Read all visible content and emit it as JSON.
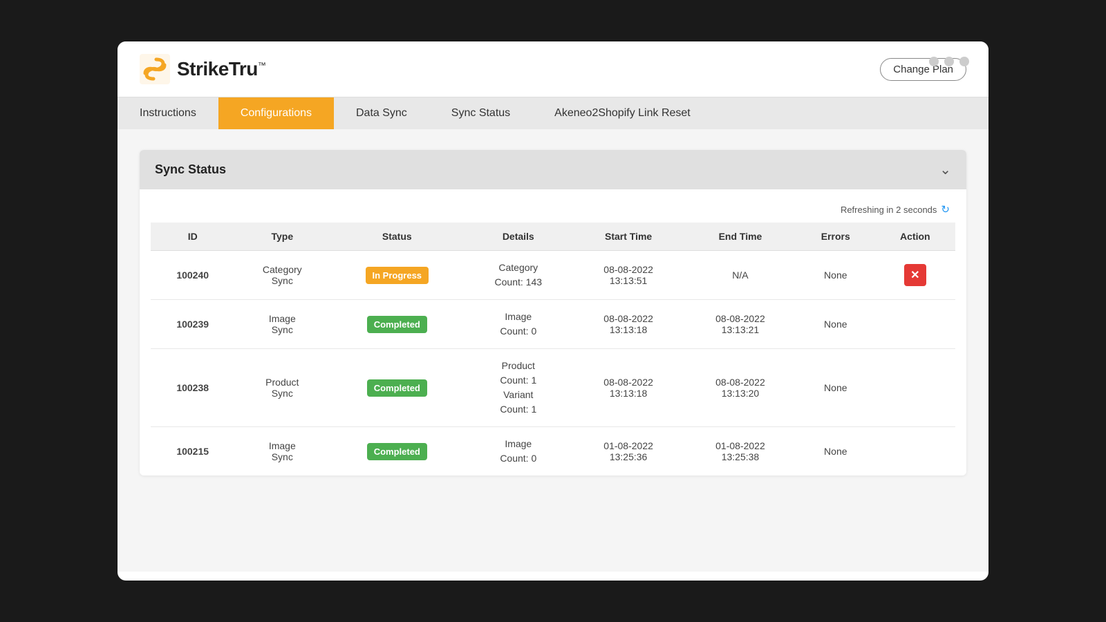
{
  "window": {
    "controls": [
      "dot1",
      "dot2",
      "dot3"
    ]
  },
  "header": {
    "logo_text": "StrikeTru",
    "logo_tm": "™",
    "change_plan_label": "Change Plan"
  },
  "nav": {
    "items": [
      {
        "label": "Instructions",
        "active": false
      },
      {
        "label": "Configurations",
        "active": true
      },
      {
        "label": "Data Sync",
        "active": false
      },
      {
        "label": "Sync Status",
        "active": false
      },
      {
        "label": "Akeneo2Shopify Link Reset",
        "active": false
      }
    ]
  },
  "sync_status_panel": {
    "title": "Sync Status",
    "refresh_text": "Refreshing in 2 seconds",
    "table": {
      "columns": [
        "ID",
        "Type",
        "Status",
        "Details",
        "Start Time",
        "End Time",
        "Errors",
        "Action"
      ],
      "rows": [
        {
          "id": "100240",
          "type": "Category\nSync",
          "status": "In Progress",
          "status_class": "in-progress",
          "details": "Category\nCount: 143",
          "start_time": "08-08-2022\n13:13:51",
          "end_time": "N/A",
          "errors": "None",
          "has_action": true
        },
        {
          "id": "100239",
          "type": "Image\nSync",
          "status": "Completed",
          "status_class": "completed",
          "details": "Image\nCount: 0",
          "start_time": "08-08-2022\n13:13:18",
          "end_time": "08-08-2022\n13:13:21",
          "errors": "None",
          "has_action": false
        },
        {
          "id": "100238",
          "type": "Product\nSync",
          "status": "Completed",
          "status_class": "completed",
          "details": "Product\nCount: 1\nVariant\nCount: 1",
          "start_time": "08-08-2022\n13:13:18",
          "end_time": "08-08-2022\n13:13:20",
          "errors": "None",
          "has_action": false
        },
        {
          "id": "100215",
          "type": "Image\nSync",
          "status": "Completed",
          "status_class": "completed",
          "details": "Image\nCount: 0",
          "start_time": "01-08-2022\n13:25:36",
          "end_time": "01-08-2022\n13:25:38",
          "errors": "None",
          "has_action": false
        }
      ]
    }
  }
}
